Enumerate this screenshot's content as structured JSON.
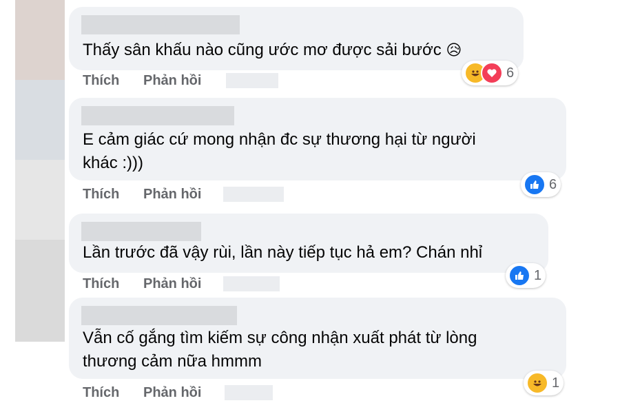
{
  "colors": {
    "bubble": "#f0f2f5",
    "action_text": "#65676b",
    "like_blue": "#1877f2",
    "haha_yellow": "#f7b928",
    "love_red": "#f33e58"
  },
  "comments": [
    {
      "text_lines": [
        "Thấy sân khấu nào cũng ước mơ được sải bước"
      ],
      "emoji": "😥",
      "actions": {
        "like": "Thích",
        "reply": "Phản hồi"
      },
      "reactions": {
        "icons": [
          "haha-icon",
          "love-icon"
        ],
        "count": "6"
      }
    },
    {
      "text_lines": [
        "E cảm giác cứ mong nhận đc sự thương hại từ người",
        "khác :)))"
      ],
      "actions": {
        "like": "Thích",
        "reply": "Phản hồi"
      },
      "reactions": {
        "icons": [
          "like-icon"
        ],
        "count": "6"
      }
    },
    {
      "text_lines": [
        "Lần trước đã vậy rùi, lần này tiếp tục hả em? Chán nhỉ"
      ],
      "actions": {
        "like": "Thích",
        "reply": "Phản hồi"
      },
      "reactions": {
        "icons": [
          "like-icon"
        ],
        "count": "1"
      }
    },
    {
      "text_lines": [
        "Vẫn cố gắng tìm kiếm sự công nhận xuất phát từ lòng",
        "thương cảm nữa hmmm"
      ],
      "actions": {
        "like": "Thích",
        "reply": "Phản hồi"
      },
      "reactions": {
        "icons": [
          "haha-icon"
        ],
        "count": "1"
      }
    }
  ]
}
